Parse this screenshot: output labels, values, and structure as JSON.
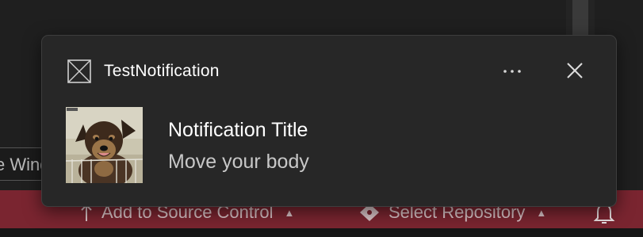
{
  "background": {
    "side_input_text": "e Wind",
    "status_bar": {
      "add_to_source_control_label": "Add to Source Control",
      "select_repository_label": "Select Repository"
    },
    "colors": {
      "status_bar": "#7a2530"
    }
  },
  "notification": {
    "app_name": "TestNotification",
    "more_label": "···",
    "title": "Notification Title",
    "message": "Move your body",
    "image_icon": "dog-photo",
    "colors": {
      "background": "#272727",
      "title": "#ffffff",
      "message": "#c8c8c8"
    }
  }
}
